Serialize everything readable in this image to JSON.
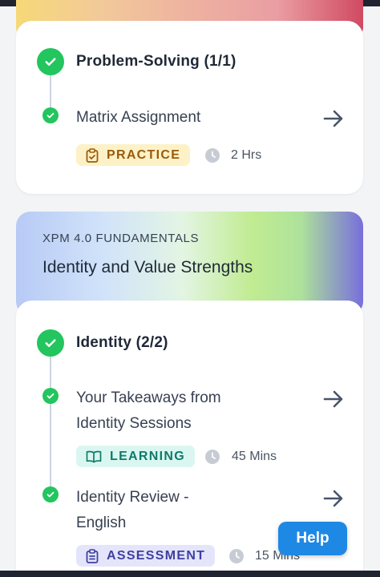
{
  "colors": {
    "check_green": "#22c55e",
    "help_blue": "#1e88e5",
    "practice_bg": "#fdf1c7",
    "learning_bg": "#d9f7f0",
    "assessment_bg": "#e4e5fb"
  },
  "section1": {
    "module": {
      "title": "Problem-Solving (1/1)"
    },
    "items": [
      {
        "title": "Matrix Assignment",
        "badge": "PRACTICE",
        "duration": "2 Hrs",
        "badge_icon": "clipboard-check-icon"
      }
    ]
  },
  "section2": {
    "subtitle": "XPM 4.0 FUNDAMENTALS",
    "title": "Identity and Value Strengths",
    "module": {
      "title": "Identity (2/2)"
    },
    "items": [
      {
        "title_line1": "Your Takeaways from",
        "title_line2": "Identity Sessions",
        "badge": "LEARNING",
        "duration": "45 Mins",
        "badge_icon": "book-icon"
      },
      {
        "title_line1": "Identity Review -",
        "title_line2": "English",
        "badge": "ASSESSMENT",
        "duration": "15 Mins",
        "badge_icon": "clipboard-list-icon"
      }
    ]
  },
  "help": {
    "label": "Help"
  }
}
